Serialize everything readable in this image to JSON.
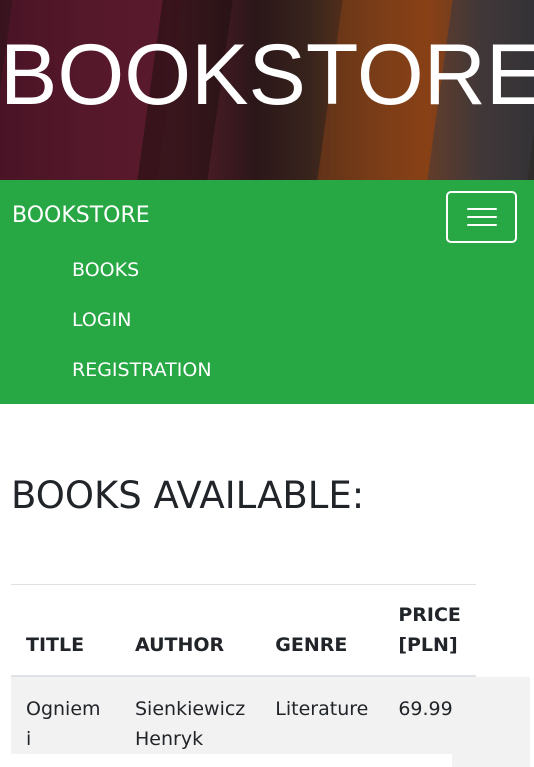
{
  "banner": {
    "title": "BOOKSTORE"
  },
  "navbar": {
    "brand": "BOOKSTORE",
    "items": [
      {
        "label": "BOOKS"
      },
      {
        "label": "LOGIN"
      },
      {
        "label": "REGISTRATION"
      }
    ],
    "toggler_icon": "hamburger-menu-icon",
    "color": "#28a745"
  },
  "main": {
    "heading": "BOOKS AVAILABLE:",
    "table": {
      "headers": [
        "TITLE",
        "AUTHOR",
        "GENRE",
        "PRICE [PLN]"
      ],
      "rows": [
        {
          "title": "Ogniem i",
          "author": "Sienkiewicz Henryk",
          "genre": "Literature",
          "price": "69.99"
        }
      ]
    }
  }
}
